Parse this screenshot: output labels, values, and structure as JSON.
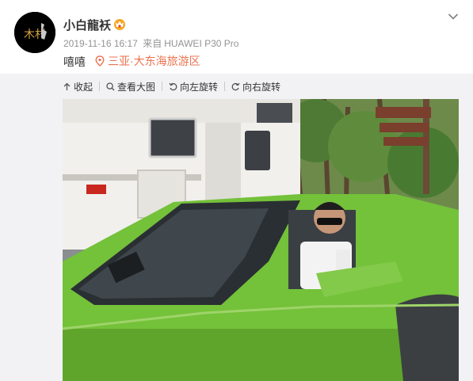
{
  "post": {
    "username": "小白龍袄",
    "timestamp": "2019-11-16 16:17",
    "source_prefix": "来自",
    "source_device": "HUAWEI P30 Pro",
    "text": "嘻嘻",
    "location": "三亚·大东海旅游区",
    "avatar_label": "木村"
  },
  "toolbar": {
    "collapse_label": "收起",
    "view_large_label": "查看大图",
    "rotate_left_label": "向左旋转",
    "rotate_right_label": "向右旋转"
  },
  "icons": {
    "vip": "vip-crown-icon",
    "dropdown": "chevron-down-icon",
    "location": "location-pin-icon",
    "collapse": "collapse-arrow-icon",
    "view_large": "magnifier-icon",
    "rotate_left": "rotate-left-icon",
    "rotate_right": "rotate-right-icon"
  },
  "colors": {
    "location_text": "#eb7350",
    "meta_text": "#939393",
    "panel_bg": "#f2f2f5",
    "car_green": "#74c13a"
  }
}
